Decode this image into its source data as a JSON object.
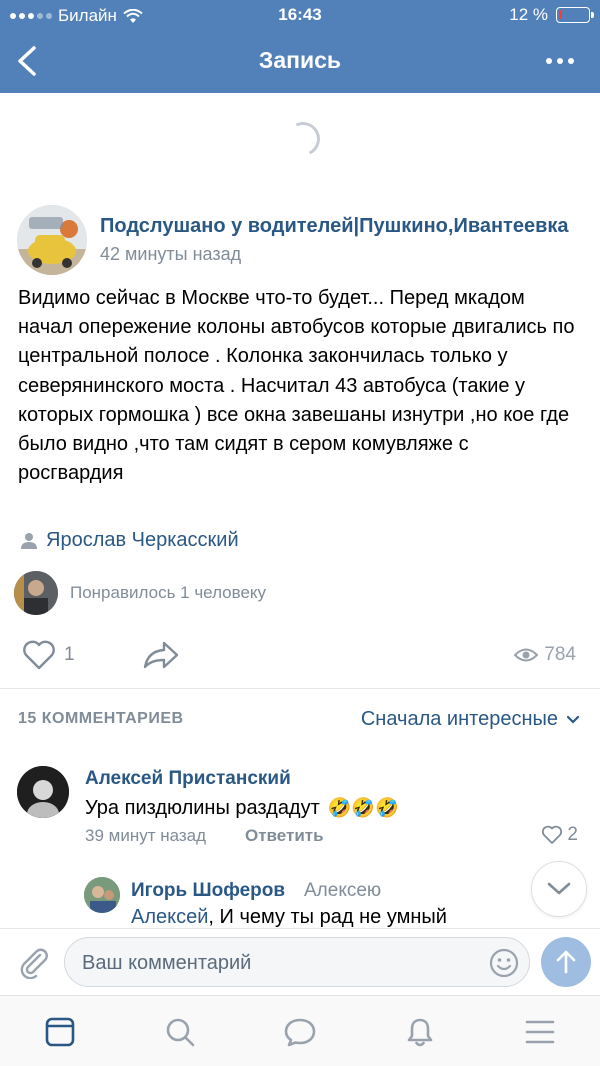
{
  "status_bar": {
    "carrier": "Билайн",
    "time": "16:43",
    "battery_percent": "12 %",
    "battery_level": 0.12
  },
  "nav": {
    "title": "Запись"
  },
  "post": {
    "group_name": "Подслушано у водителей|Пушкино,Ивантеевка",
    "time": "42 минуты назад",
    "text": "Видимо сейчас в Москве что-то будет... Перед мкадом начал опережение колоны автобусов которые двигались по центральной полосе . Колонка закончилась только у северянинского моста . Насчитал 43 автобуса (такие у которых гормошка ) все окна завешаны изнутри ,но кое где было видно ,что там сидят в сером комувляже с росгвардия",
    "author": "Ярослав Черкасский",
    "liked_by": "Понравилось 1 человеку",
    "likes": "1",
    "views": "784"
  },
  "comments": {
    "count_label": "15 КОММЕНТАРИЕВ",
    "sort_label": "Сначала интересные",
    "first": {
      "author": "Алексей Пристанский",
      "text": "Ура пиздюлины раздадут",
      "emoji": "🤣🤣🤣",
      "time": "39 минут назад",
      "reply_label": "Ответить",
      "likes": "2"
    },
    "reply": {
      "author": "Игорь Шоферов",
      "to": "Алексею",
      "mention": "Алексей",
      "text": ", И чему ты рад не умный"
    }
  },
  "composer": {
    "placeholder": "Ваш комментарий"
  },
  "colors": {
    "header": "#5181b8",
    "link": "#2a5885",
    "secondary": "#818c99"
  }
}
